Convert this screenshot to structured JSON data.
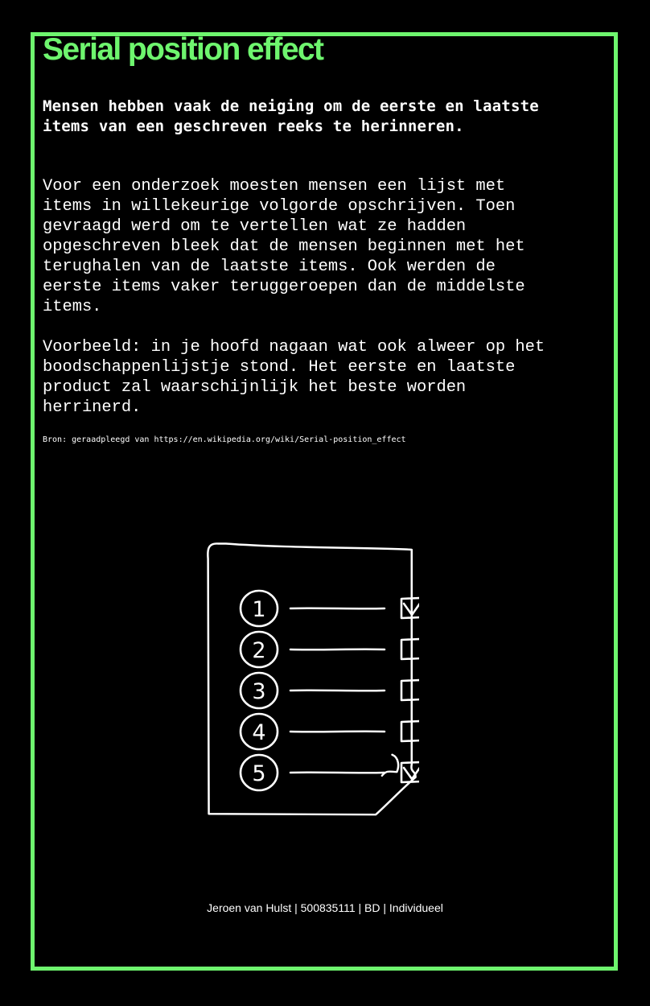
{
  "accent_color": "#6ef56e",
  "background_color": "#000000",
  "title": "Serial position effect",
  "lead": "Mensen hebben vaak de neiging om de eerste en laatste items van een geschreven reeks te herinneren.",
  "paragraphs": [
    "Voor een onderzoek moesten mensen een lijst met items in willekeurige volgorde opschrijven. Toen gevraagd werd om te vertellen wat ze hadden opgeschreven bleek dat de mensen beginnen met het terughalen van de laatste items. Ook werden de eerste items vaker teruggeroepen dan de middelste items.",
    "Voorbeeld: in je hoofd nagaan wat ook alweer op het boodschappenlijstje stond. Het eerste en laatste product zal waarschijnlijk het beste worden herrinerd."
  ],
  "source": "Bron: geraadpleegd van https://en.wikipedia.org/wiki/Serial-position_effect",
  "checklist": {
    "icon": "checklist-illustration",
    "items": [
      {
        "number": "1",
        "checked": true
      },
      {
        "number": "2",
        "checked": false
      },
      {
        "number": "3",
        "checked": false
      },
      {
        "number": "4",
        "checked": false
      },
      {
        "number": "5",
        "checked": true
      }
    ]
  },
  "footer": "Jeroen van Hulst | 500835111 | BD | Individueel"
}
